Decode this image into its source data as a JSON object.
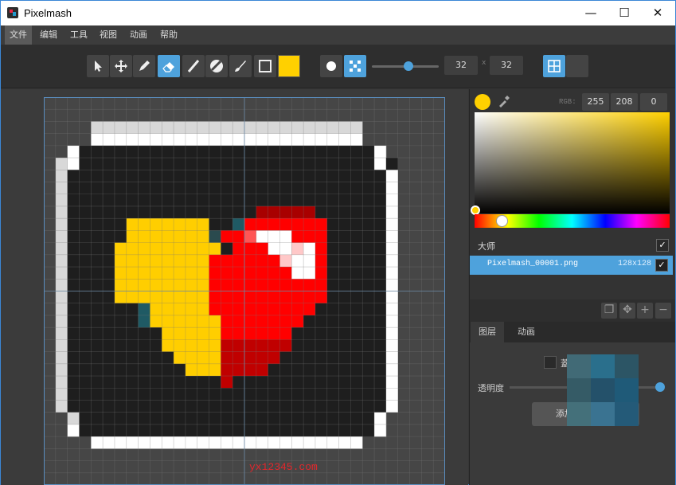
{
  "window": {
    "title": "Pixelmash",
    "minimize": "—",
    "maximize": "☐",
    "close": "✕"
  },
  "menu": [
    "文件",
    "编辑",
    "工具",
    "视图",
    "动画",
    "帮助"
  ],
  "toolbar": {
    "tools": [
      "pointer-icon",
      "move-icon",
      "pencil-icon",
      "eraser-icon",
      "line-icon",
      "fill-icon",
      "brush-icon",
      "rect-icon"
    ],
    "active_tool": "eraser-icon",
    "primary_color": "#ffd000",
    "brush_shape_round": "round-icon",
    "brush_shape_dither": "dither-icon",
    "brush_size_slider_fraction": 0.55,
    "width": "32",
    "height": "32",
    "size_separator": "x",
    "grid_toggle": true
  },
  "canvas": {
    "watermark": "yx12345.com",
    "grid_cols": 34,
    "grid_rows": 32,
    "palette": {
      "k": "#1e1e1e",
      "w": "#ffffff",
      "g": "#d8d8d8",
      "y": "#ffce00",
      "r": "#ff0000",
      "d": "#c00000",
      "m": "#a80000",
      "p": "#ff5555",
      "q": "#ffc8c8",
      "t": "#1f5a64",
      "s": "#2a4a4e"
    }
  },
  "color_panel": {
    "rgb_label": "RGB:",
    "r": "255",
    "g": "208",
    "b": "0",
    "swatch_color": "#ffd000"
  },
  "layers": {
    "group_label": "大师",
    "items": [
      {
        "name": "Pixelmash_00001.png",
        "size": "128x128"
      }
    ]
  },
  "tabs": {
    "labels": [
      "图层",
      "动画"
    ]
  },
  "properties": {
    "blend_label_fragment": "蓋",
    "opacity_label": "透明度",
    "add_button_fragment": "添加"
  }
}
